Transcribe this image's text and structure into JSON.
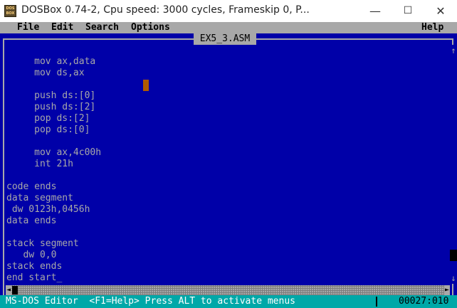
{
  "window": {
    "title": "DOSBox 0.74-2, Cpu speed:     3000 cycles, Frameskip  0, P...",
    "icon_text": "DOS BOX",
    "minimize_glyph": "—",
    "maximize_glyph": "☐",
    "close_glyph": "✕"
  },
  "menu": {
    "file": "File",
    "edit": "Edit",
    "search": "Search",
    "options": "Options",
    "help": "Help"
  },
  "editor": {
    "filename": "EX5_3.ASM",
    "lines": [
      "     mov ax,data",
      "     mov ds,ax",
      "",
      "     push ds:[0]",
      "     push ds:[2]",
      "     pop ds:[2]",
      "     pop ds:[0]",
      "",
      "     mov ax,4c00h",
      "     int 21h",
      "",
      "code ends",
      "data segment",
      " dw 0123h,0456h",
      "data ends",
      "",
      "stack segment",
      "   dw 0,0",
      "stack ends",
      "end start_"
    ]
  },
  "scrollbars": {
    "up_glyph": "↑",
    "down_glyph": "↓",
    "left_glyph": "◄",
    "right_glyph": "►"
  },
  "status": {
    "message": "MS-DOS Editor  <F1=Help> Press ALT to activate menus",
    "position": "00027:010"
  },
  "colors": {
    "dos_blue": "#0000a8",
    "dos_gray": "#a8a8a8",
    "dos_cyan": "#00a8a8",
    "cursor_orange": "#b05a00"
  }
}
